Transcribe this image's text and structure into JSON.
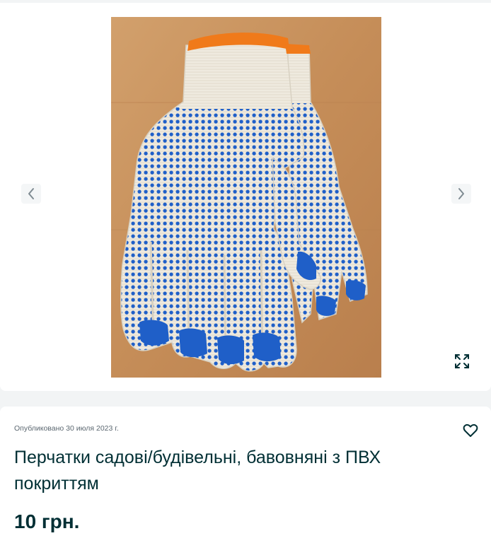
{
  "gallery": {
    "image_alt": "Перчатки садові/будівельні, бавовняні з ПВХ покриттям",
    "prev_icon": "chevron-left-icon",
    "next_icon": "chevron-right-icon",
    "fullscreen_icon": "expand-icon"
  },
  "listing": {
    "published": "Опубликовано 30 июля 2023 г.",
    "title": "Перчатки садові/будівельні, бавовняні з ПВХ покриттям",
    "price": "10 грн.",
    "favorite_icon": "heart-icon"
  },
  "colors": {
    "page_background": "#f2f4f5",
    "text_dark": "#002f34",
    "text_muted": "#5b6770",
    "glove_dots": "#1f5fc8",
    "glove_knit": "#f1ece1",
    "table_wood": "#c9935e"
  }
}
